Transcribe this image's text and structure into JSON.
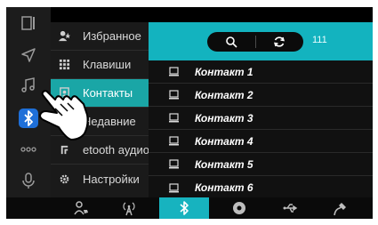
{
  "rail": {
    "icons": [
      "window-icon",
      "navigation-icon",
      "music-icon",
      "bluetooth-icon",
      "more-icon",
      "microphone-icon",
      "back-icon"
    ],
    "active": "bluetooth-icon",
    "active_color": "#1e6fd8"
  },
  "menu": {
    "items": [
      {
        "label": "Избранное",
        "icon": "favorites-contact-icon"
      },
      {
        "label": "Клавиши",
        "icon": "keypad-icon"
      },
      {
        "label": "Контакты",
        "icon": "contacts-icon"
      },
      {
        "label": "Недавние",
        "icon": "recent-calls-icon"
      },
      {
        "label": "etooth аудио",
        "icon": "bluetooth-audio-icon"
      },
      {
        "label": "Настройки",
        "icon": "settings-icon"
      }
    ],
    "active_index": 2,
    "active_color": "#1aa6a6"
  },
  "contacts": {
    "header_color": "#13b3bf",
    "count": "111",
    "items": [
      "Контакт 1",
      "Контакт 2",
      "Контакт 3",
      "Контакт 4",
      "Контакт 5",
      "Контакт 6"
    ]
  },
  "bottombar": {
    "icons": [
      "phone-icon",
      "antenna-icon",
      "bluetooth-icon",
      "disc-icon",
      "usb-icon",
      "aux-icon"
    ],
    "active": "bluetooth-icon"
  }
}
